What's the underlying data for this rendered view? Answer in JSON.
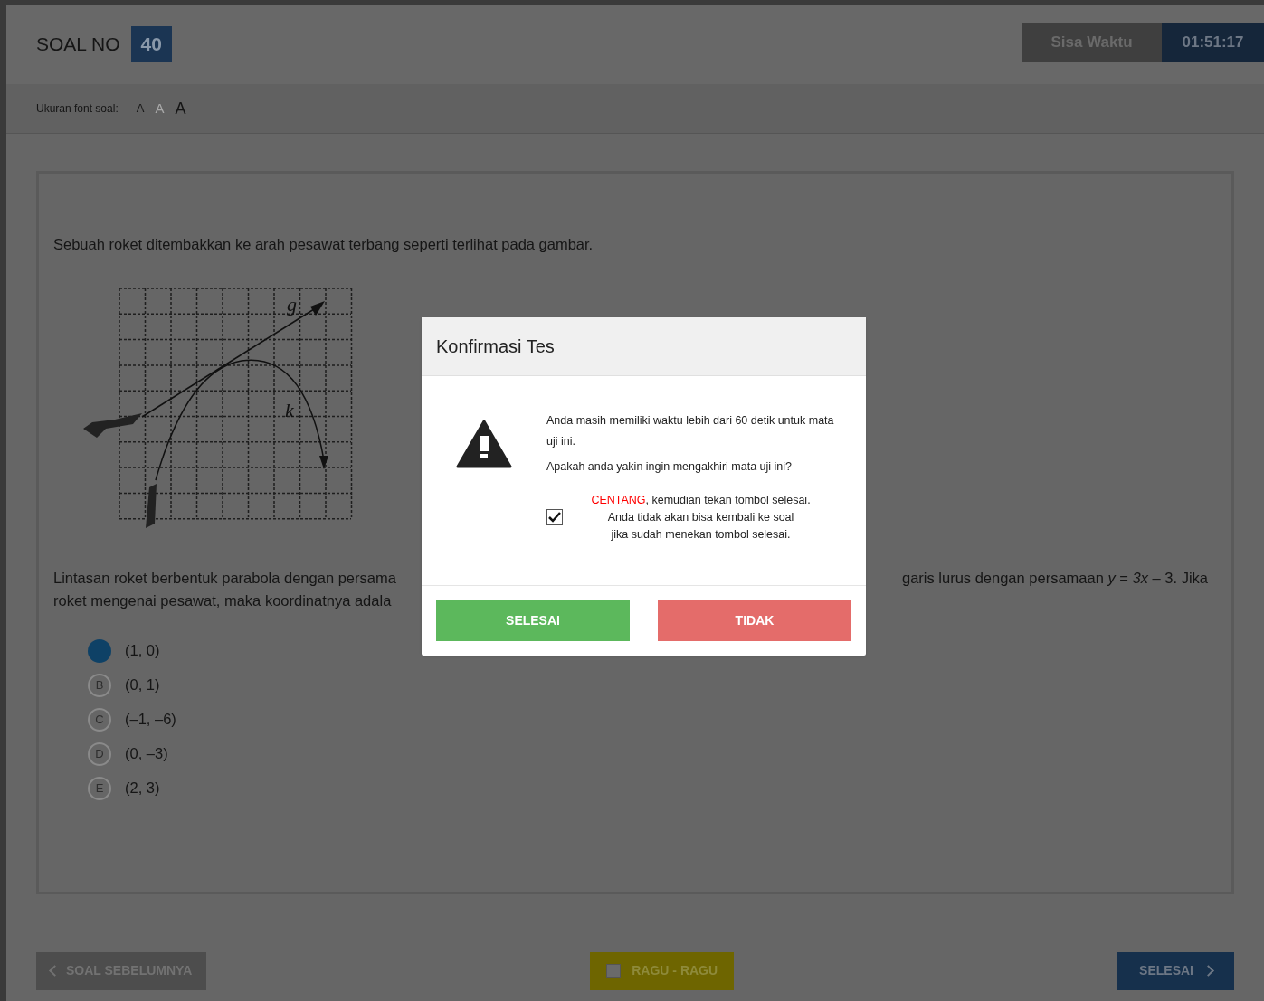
{
  "header": {
    "title": "SOAL NO",
    "number": "40",
    "timer_label": "Sisa Waktu",
    "timer": "01:51:17"
  },
  "font_size": {
    "label": "Ukuran font soal:",
    "options": [
      {
        "letter": "A",
        "kind": "small",
        "selected": false
      },
      {
        "letter": "A",
        "kind": "medium",
        "selected": true
      },
      {
        "letter": "A",
        "kind": "large",
        "selected": false
      }
    ]
  },
  "question": {
    "intro": "Sebuah roket ditembakkan ke arah pesawat terbang seperti terlihat pada gambar.",
    "diagram_labels": [
      "g",
      "k"
    ],
    "line_1_left": "Lintasan roket berbentuk parabola dengan persama",
    "line_1_right": "garis lurus dengan persamaan *y* = *3x* – 3. Jika",
    "line_2_left": "roket mengenai pesawat, maka koordinatnya adala"
  },
  "options": [
    {
      "text": "(1, 0)",
      "selected": true
    },
    {
      "letter": "B",
      "text": "(0, 1)",
      "selected": false
    },
    {
      "letter": "C",
      "text": "(–1, –6)",
      "selected": false
    },
    {
      "letter": "D",
      "text": "(0, –3)",
      "selected": false
    },
    {
      "letter": "E",
      "text": "(2, 3)",
      "selected": false
    }
  ],
  "footer": {
    "prev": "SOAL SEBELUMNYA",
    "doubt": "RAGU - RAGU",
    "doubt_checked": false,
    "finish": "SELESAI"
  },
  "dialog": {
    "title": "Konfirmasi Tes",
    "message_1": "Anda masih memiliki waktu lebih dari 60 detik untuk mata uji ini.",
    "message_2": "Apakah anda yakin ingin mengakhiri mata uji ini?",
    "confirm_note": "CENTANG",
    "confirm_rest": ", kemudian tekan tombol selesai.",
    "confirm_line_2": "Anda tidak akan bisa kembali ke soal",
    "confirm_line_3": "jika sudah menekan tombol selesai.",
    "checked": true,
    "ok": "SELESAI",
    "cancel": "TIDAK"
  }
}
